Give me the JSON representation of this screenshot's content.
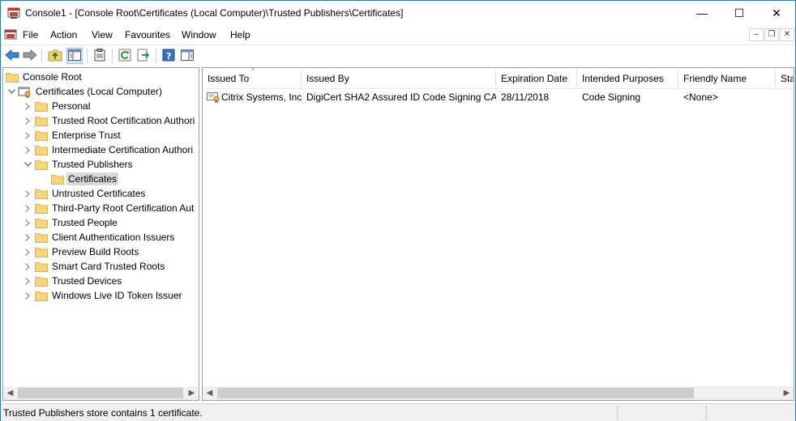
{
  "window": {
    "title": "Console1 - [Console Root\\Certificates (Local Computer)\\Trusted Publishers\\Certificates]",
    "minimize": "—",
    "maximize": "☐",
    "close": "✕"
  },
  "menu": {
    "items": [
      "File",
      "Action",
      "View",
      "Favourites",
      "Window",
      "Help"
    ],
    "mdi_minimize": "–",
    "mdi_restore": "❐",
    "mdi_close": "✕"
  },
  "toolbar": {
    "icons": [
      "back-arrow-icon",
      "forward-arrow-icon",
      "up-folder-icon",
      "show-hide-tree-icon",
      "properties-clipboard-icon",
      "refresh-icon",
      "export-list-icon",
      "help-icon",
      "action-pane-icon"
    ]
  },
  "tree": {
    "root": "Console Root",
    "certs_root": "Certificates (Local Computer)",
    "items": [
      "Personal",
      "Trusted Root Certification Authori",
      "Enterprise Trust",
      "Intermediate Certification Authori",
      "Trusted Publishers",
      "Certificates",
      "Untrusted Certificates",
      "Third-Party Root Certification Aut",
      "Trusted People",
      "Client Authentication Issuers",
      "Preview Build Roots",
      "Smart Card Trusted Roots",
      "Trusted Devices",
      "Windows Live ID Token Issuer"
    ],
    "selected": "Certificates"
  },
  "list": {
    "columns": [
      "Issued To",
      "Issued By",
      "Expiration Date",
      "Intended Purposes",
      "Friendly Name",
      "Sta"
    ],
    "rows": [
      {
        "issued_to": "Citrix Systems, Inc.",
        "issued_by": "DigiCert SHA2 Assured ID Code Signing CA",
        "expiration": "28/11/2018",
        "purposes": "Code Signing",
        "friendly": "<None>"
      }
    ]
  },
  "status": {
    "text": "Trusted Publishers store contains 1 certificate."
  },
  "colors": {
    "window_border": "#2b79c2",
    "folder_yellow": "#f5d67a",
    "folder_edge": "#d9b44a",
    "selection_gray": "#d9d9d9"
  }
}
